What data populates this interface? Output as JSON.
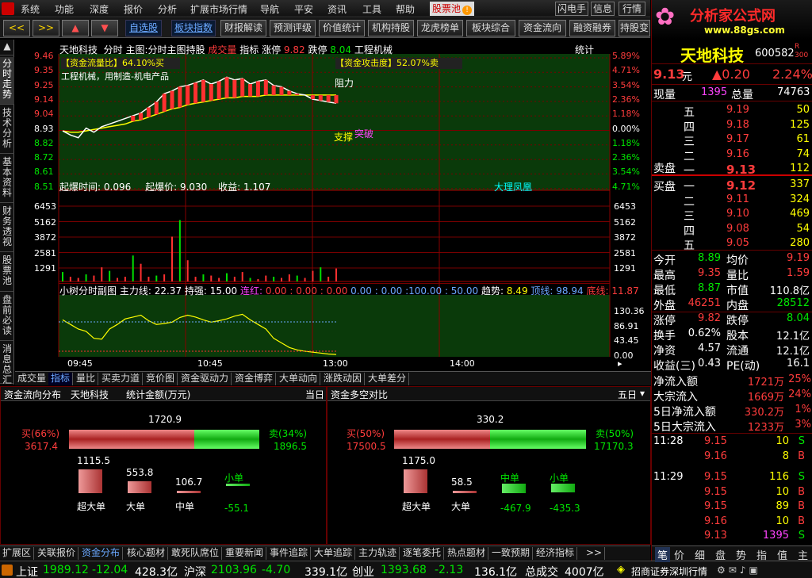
{
  "menu": {
    "items": [
      "系统",
      "功能",
      "深度",
      "报价",
      "分析",
      "扩展市场行情",
      "导航",
      "平安",
      "资讯",
      "工具",
      "帮助"
    ],
    "selected": "股票池",
    "right_buttons": [
      "闪电手",
      "信息",
      "行情"
    ]
  },
  "toolbar": {
    "nav": [
      "<<",
      ">>",
      "▲",
      "▼"
    ],
    "links": [
      "自选股",
      "板块指数"
    ],
    "buttons": [
      "财报解读",
      "预测评级",
      "价值统计",
      "机构持股",
      "龙虎榜单",
      "板块综合",
      "资金流向",
      "融资融券",
      "持股变"
    ]
  },
  "left_tabs": [
    "分时走势",
    "技术分析",
    "基本资料",
    "财务透视",
    "股票池",
    "盘前必读",
    "消息总汇"
  ],
  "chart": {
    "header": {
      "name": "天地科技",
      "mode": "分时",
      "main_label": "主图:分时主图持股",
      "vol_label": "成交量",
      "indicator": "指标",
      "zt_label": "涨停",
      "zt": "9.82",
      "dt_label": "跌停",
      "dt": "8.04",
      "sector": "工程机械",
      "stat": "统计"
    },
    "left_prices": [
      "9.46",
      "9.35",
      "9.25",
      "9.14",
      "9.04",
      "8.93",
      "8.82",
      "8.72",
      "8.61",
      "8.51"
    ],
    "right_pcts": [
      "5.89%",
      "4.71%",
      "3.54%",
      "2.36%",
      "1.18%",
      "0.00%",
      "1.18%",
      "2.36%",
      "3.54%",
      "4.71%"
    ],
    "flow_tag": "【资金流量比】64.10%买",
    "attack_tag": "【资金攻击度】52.07%卖",
    "sector_tag": "工程机械，用制造-机电产品",
    "resist": "阻力",
    "support": "支撑",
    "break": "突破",
    "burst": {
      "t_label": "起爆时间:",
      "t": "0.096",
      "p_label": "起爆价:",
      "p": "9.030",
      "g_label": "收益:",
      "g": "1.107"
    },
    "signature": "大理凤凰",
    "vol_ticks": [
      "6453",
      "5162",
      "3872",
      "2581",
      "1291"
    ],
    "sub": {
      "name": "小树分时副图",
      "zl_label": "主力线:",
      "zl": "22.37",
      "cp_label": "持强:",
      "cp": "15.00",
      "lh_label": "连红:",
      "lh": "0.00 : 0.00 : 0.00",
      "mid": "0.00 : 0.00 :100.00 : 50.00",
      "qs_label": "趋势:",
      "qs": "8.49",
      "yx_label": "顶线:",
      "yx": "98.94",
      "dx_label": "底线:",
      "dx": "11.87"
    },
    "sub_ticks": [
      "130.36",
      "86.91",
      "43.45",
      "0.00"
    ],
    "time_ticks": [
      "09:45",
      "10:45",
      "13:00",
      "14:00"
    ],
    "price_series": [
      8.93,
      8.9,
      8.88,
      8.95,
      8.92,
      8.96,
      8.98,
      9.0,
      9.02,
      9.04,
      9.06,
      9.1,
      9.14,
      9.2,
      9.22,
      9.25,
      9.26,
      9.28,
      9.3,
      9.27,
      9.29,
      9.32,
      9.3,
      9.31,
      9.27,
      9.29,
      9.3,
      9.26,
      9.25,
      9.22,
      9.2,
      9.19,
      9.16,
      9.15,
      9.14,
      9.13
    ],
    "avg_series": [
      8.93,
      8.92,
      8.92,
      8.93,
      8.94,
      8.95,
      8.96,
      8.97,
      8.98,
      9.0,
      9.01,
      9.03,
      9.05,
      9.07,
      9.09,
      9.1,
      9.12,
      9.13,
      9.14,
      9.15,
      9.16,
      9.17,
      9.17,
      9.18,
      9.18,
      9.18,
      9.19,
      9.19,
      9.19,
      9.19,
      9.19,
      9.19,
      9.19,
      9.19,
      9.19,
      9.19
    ],
    "vol_series": [
      800,
      400,
      300,
      600,
      500,
      1200,
      900,
      300,
      400,
      2200,
      1500,
      400,
      500,
      600,
      3800,
      5200,
      1800,
      400,
      600,
      500,
      300,
      700,
      400,
      800,
      300,
      200,
      500,
      400,
      300,
      600,
      500,
      300,
      900,
      1200,
      400,
      1100
    ],
    "sub_series": [
      80,
      70,
      60,
      55,
      40,
      38,
      60,
      70,
      82,
      86,
      90,
      78,
      70,
      72,
      75,
      85,
      90,
      86,
      80,
      75,
      78,
      82,
      88,
      92,
      80,
      70,
      60,
      40,
      30,
      20,
      15,
      12,
      10,
      8,
      6,
      5
    ]
  },
  "subtabs": [
    "成交量",
    "指标",
    "量比",
    "买卖力道",
    "竞价图",
    "资金驱动力",
    "资金博弈",
    "大单动向",
    "涨跌动因",
    "大单差分"
  ],
  "panel_left": {
    "title": "资金流向分布",
    "stock": "天地科技",
    "metric": "统计金额(万元)",
    "period": "当日",
    "total": "1720.9",
    "buy_label": "买(66%)",
    "buy": "3617.4",
    "sell_label": "卖(34%)",
    "sell": "1896.5",
    "buy_ratio": 0.66,
    "cats": [
      {
        "label": "超大单",
        "value": "1115.5",
        "v": 1115.5
      },
      {
        "label": "大单",
        "value": "553.8",
        "v": 553.8
      },
      {
        "label": "中单",
        "value": "106.7",
        "v": 106.7
      },
      {
        "label": "小单",
        "value": "-55.1",
        "v": -55.1
      }
    ]
  },
  "panel_right": {
    "title": "资金多空对比",
    "period": "五日",
    "total": "330.2",
    "buy_label": "买(50%)",
    "buy": "17500.5",
    "sell_label": "卖(50%)",
    "sell": "17170.3",
    "buy_ratio": 0.5,
    "cats": [
      {
        "label": "超大单",
        "value": "1175.0",
        "v": 1175.0
      },
      {
        "label": "大单",
        "value": "58.5",
        "v": 58.5
      },
      {
        "label": "中单",
        "value": "-467.9",
        "v": -467.9
      },
      {
        "label": "小单",
        "value": "-435.3",
        "v": -435.3
      }
    ]
  },
  "bottom_tabs": [
    "扩展区",
    "关联报价",
    "资金分布",
    "核心题材",
    "敢死队席位",
    "重要新闻",
    "事件追踪",
    "大单追踪",
    "主力轨迹",
    "逐笔委托",
    "热点题材",
    "一致预期",
    "经济指标"
  ],
  "status": {
    "sh_label": "上证",
    "sh": "1989.12",
    "sh_chg": "-12.04",
    "sh_amt": "428.3亿",
    "hs_label": "沪深",
    "hs": "2103.96",
    "hs_chg": "-4.70",
    "hs_amt": "339.1亿",
    "cy_label": "创业",
    "cy": "1393.68",
    "cy_chg": "-2.13",
    "cy_amt": "136.1亿",
    "total_label": "总成交",
    "total": "4007亿",
    "broker": "招商证券深圳行情"
  },
  "right": {
    "brand": "分析家公式网",
    "url": "www.88gs.com",
    "stock_name": "天地科技",
    "code": "600582",
    "tag_r": "R",
    "tag_n": "300",
    "price": "9.13",
    "unit": "元",
    "chg": "▲0.20",
    "pct": "2.24%",
    "xl_label": "现量",
    "xl": "1395",
    "zl_label": "总量",
    "zl": "74763",
    "asks": [
      {
        "l": "五",
        "p": "9.19",
        "v": "50"
      },
      {
        "l": "四",
        "p": "9.18",
        "v": "125"
      },
      {
        "l": "三",
        "p": "9.17",
        "v": "61"
      },
      {
        "l": "二",
        "p": "9.16",
        "v": "74"
      },
      {
        "l": "一",
        "p": "9.13",
        "v": "112"
      }
    ],
    "ask_label": "卖盘",
    "bid_label": "买盘",
    "bids": [
      {
        "l": "一",
        "p": "9.12",
        "v": "337"
      },
      {
        "l": "二",
        "p": "9.11",
        "v": "324"
      },
      {
        "l": "三",
        "p": "9.10",
        "v": "469"
      },
      {
        "l": "四",
        "p": "9.08",
        "v": "54"
      },
      {
        "l": "五",
        "p": "9.05",
        "v": "280"
      }
    ],
    "stats": [
      {
        "a": "今开",
        "av": "8.89",
        "ac": "grn",
        "b": "均价",
        "bv": "9.19",
        "bc": "red"
      },
      {
        "a": "最高",
        "av": "9.35",
        "ac": "red",
        "b": "量比",
        "bv": "1.59",
        "bc": "red"
      },
      {
        "a": "最低",
        "av": "8.87",
        "ac": "grn",
        "b": "市值",
        "bv": "110.8亿",
        "bc": "wht"
      },
      {
        "a": "外盘",
        "av": "46251",
        "ac": "red",
        "b": "内盘",
        "bv": "28512",
        "bc": "grn"
      },
      {
        "a": "涨停",
        "av": "9.82",
        "ac": "red",
        "b": "跌停",
        "bv": "8.04",
        "bc": "grn"
      },
      {
        "a": "换手",
        "av": "0.62%",
        "ac": "wht",
        "b": "股本",
        "bv": "12.1亿",
        "bc": "wht"
      },
      {
        "a": "净资",
        "av": "4.57",
        "ac": "wht",
        "b": "流通",
        "bv": "12.1亿",
        "bc": "wht"
      },
      {
        "a": "收益(三)",
        "av": "0.43",
        "ac": "wht",
        "b": "PE(动)",
        "bv": "16.1",
        "bc": "wht"
      }
    ],
    "flows": [
      {
        "l": "净流入额",
        "v": "1721万",
        "p": "25%"
      },
      {
        "l": "大宗流入",
        "v": "1669万",
        "p": "24%"
      },
      {
        "l": "5日净流入额",
        "v": "330.2万",
        "p": "1%"
      },
      {
        "l": "5日大宗流入",
        "v": "1233万",
        "p": "3%"
      }
    ],
    "ticks": [
      {
        "t": "11:28",
        "p": "9.15",
        "v": "10",
        "s": "S"
      },
      {
        "t": "",
        "p": "9.16",
        "v": "8",
        "s": "B"
      },
      {
        "t": "11:29",
        "p": "9.15",
        "v": "116",
        "s": "S"
      },
      {
        "t": "",
        "p": "9.15",
        "v": "10",
        "s": "B"
      },
      {
        "t": "",
        "p": "9.15",
        "v": "89",
        "s": "B"
      },
      {
        "t": "",
        "p": "9.16",
        "v": "10",
        "s": "B"
      },
      {
        "t": "",
        "p": "9.13",
        "v": "1395",
        "s": "S"
      }
    ],
    "tabs": [
      "笔",
      "价",
      "细",
      "盘",
      "势",
      "指",
      "值",
      "主"
    ]
  }
}
